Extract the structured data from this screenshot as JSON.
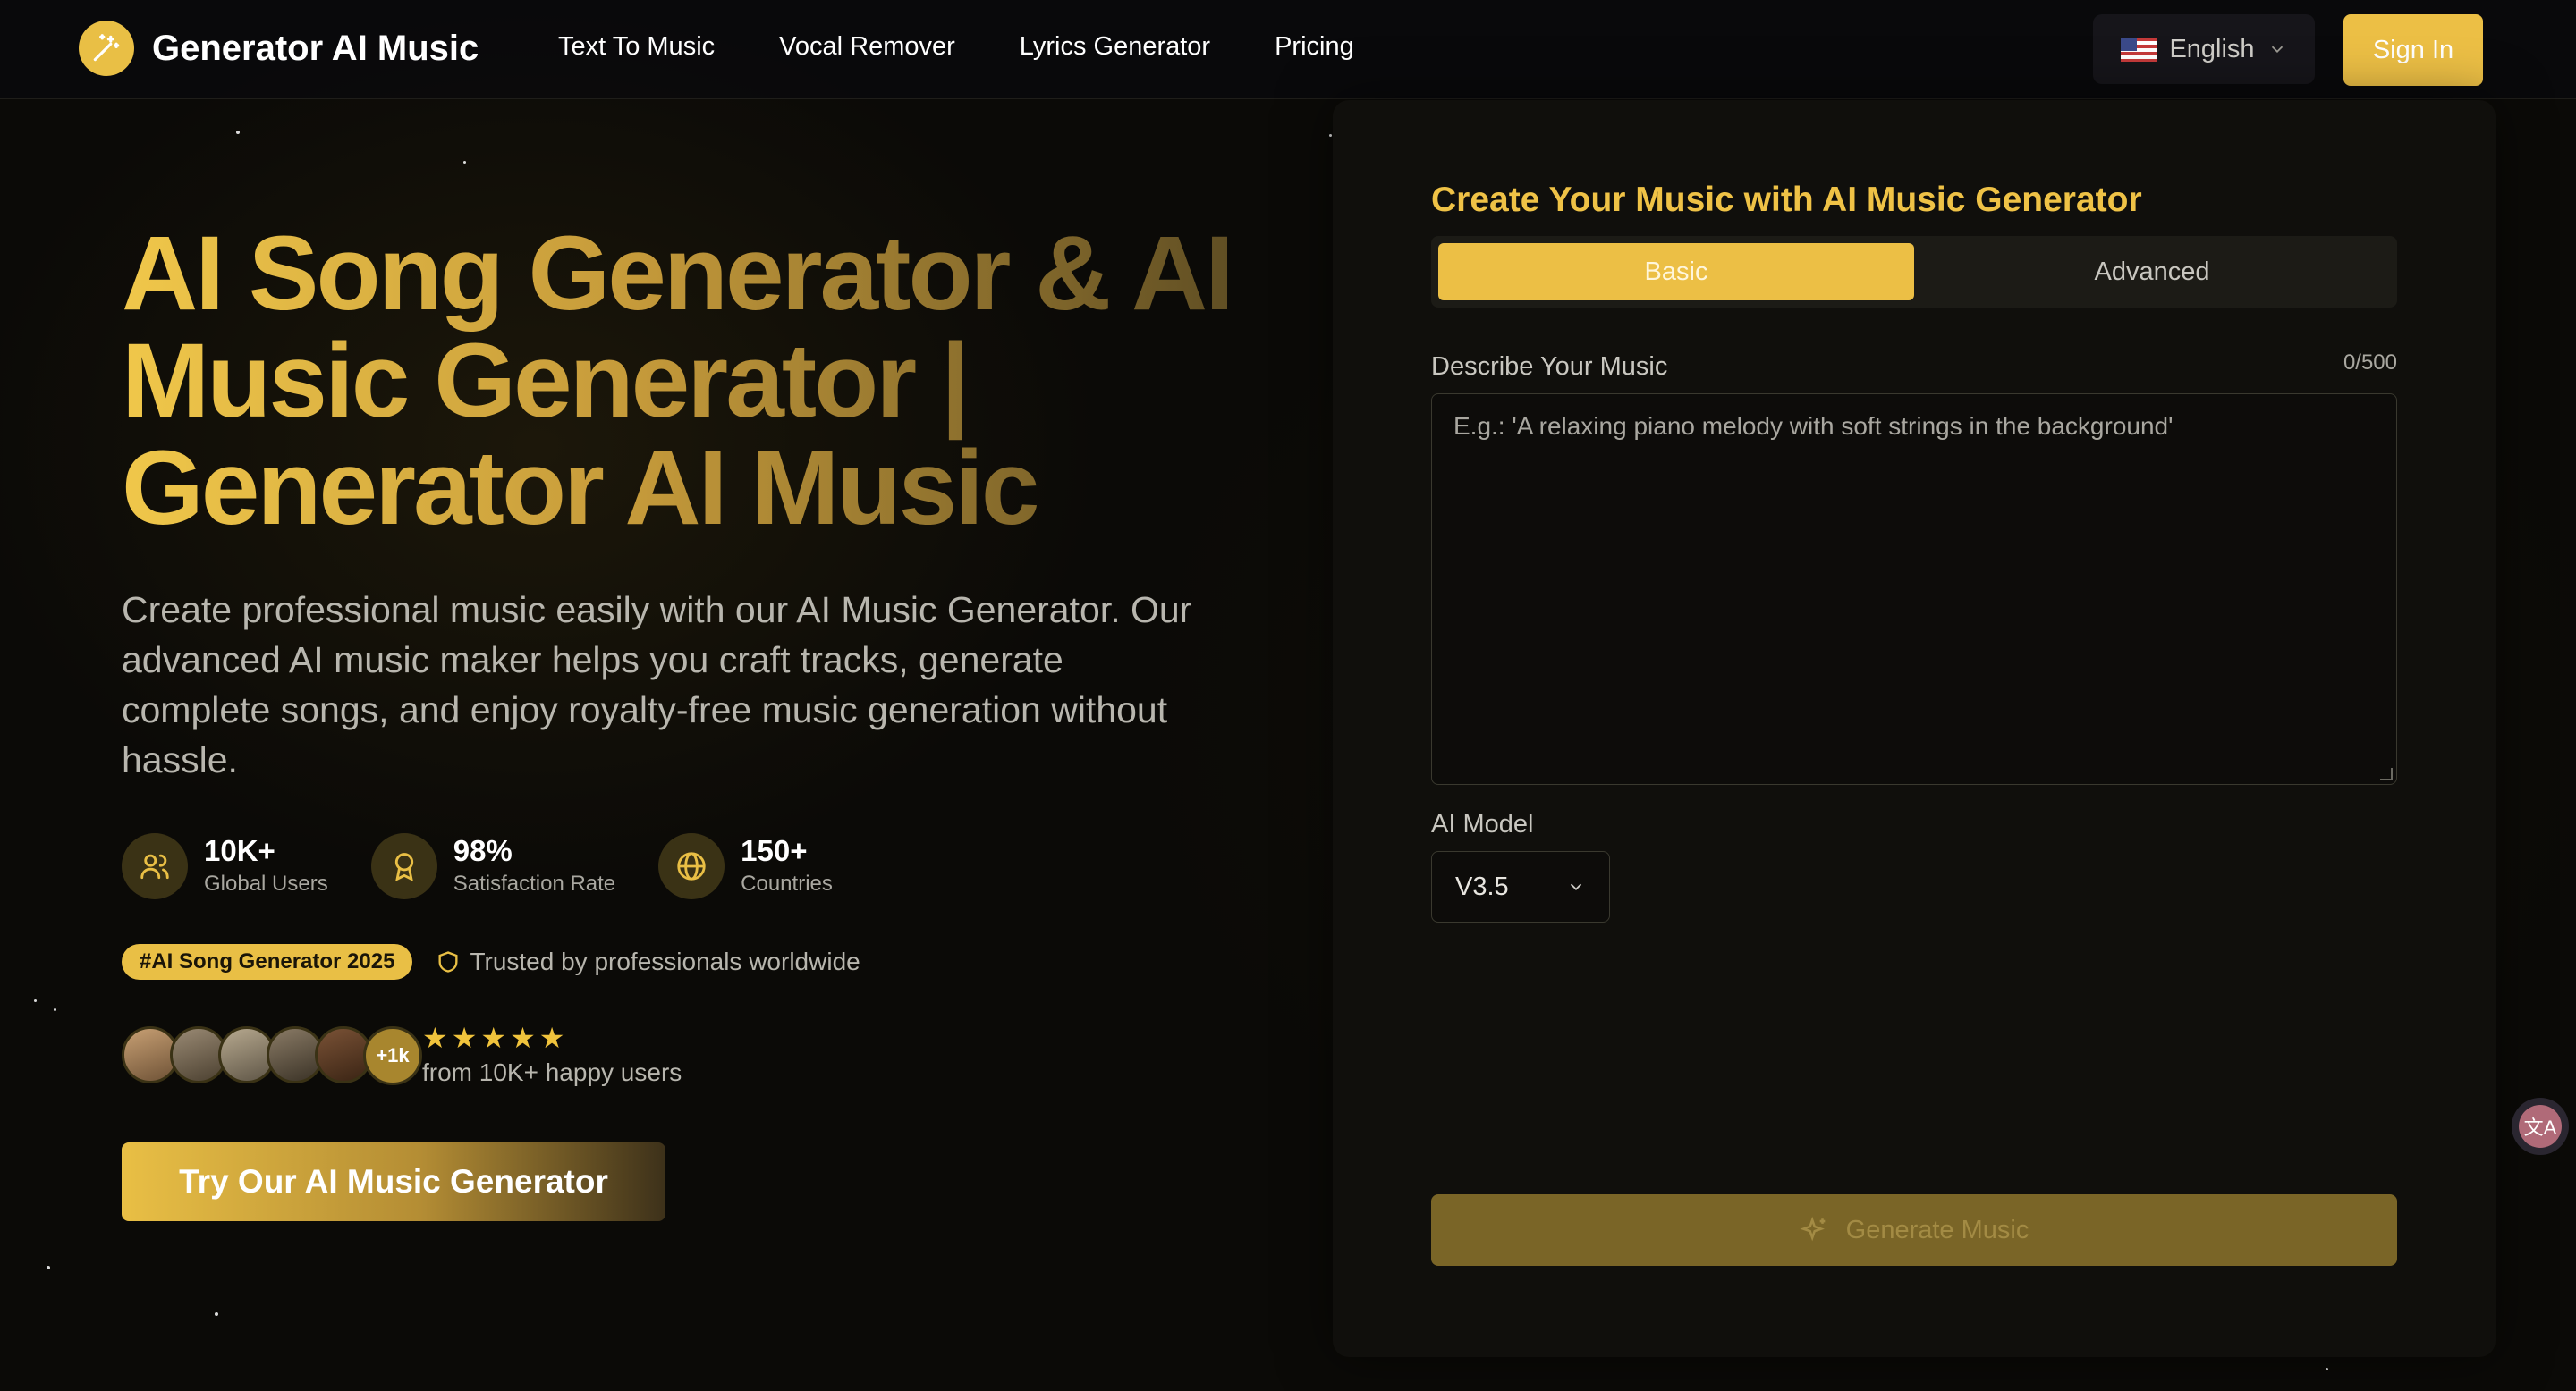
{
  "header": {
    "brand": "Generator AI Music",
    "nav": [
      "Text To Music",
      "Vocal Remover",
      "Lyrics Generator",
      "Pricing"
    ],
    "language": "English",
    "sign_in": "Sign In"
  },
  "hero": {
    "title": "AI Song Generator & AI Music Generator | Generator AI Music",
    "subtitle": "Create professional music easily with our AI Music Generator. Our advanced AI music maker helps you craft tracks, generate complete songs, and enjoy royalty-free music generation without hassle.",
    "stats": [
      {
        "value": "10K+",
        "label": "Global Users",
        "icon": "users-icon"
      },
      {
        "value": "98%",
        "label": "Satisfaction Rate",
        "icon": "award-icon"
      },
      {
        "value": "150+",
        "label": "Countries",
        "icon": "globe-icon"
      }
    ],
    "tag": "#AI Song Generator 2025",
    "trusted": "Trusted by professionals worldwide",
    "avatar_more": "+1k",
    "rating_stars": "★★★★★",
    "happy_users": "from 10K+ happy users",
    "cta": "Try Our AI Music Generator"
  },
  "panel": {
    "title": "Create Your Music with AI Music Generator",
    "tabs": {
      "basic": "Basic",
      "advanced": "Advanced"
    },
    "describe_label": "Describe Your Music",
    "counter": "0/500",
    "describe_placeholder": "E.g.: 'A relaxing piano melody with soft strings in the background'",
    "model_label": "AI Model",
    "model_value": "V3.5",
    "generate": "Generate Music"
  },
  "colors": {
    "accent": "#ecbf45",
    "background": "#0b0a07",
    "panel": "#100f0c"
  }
}
